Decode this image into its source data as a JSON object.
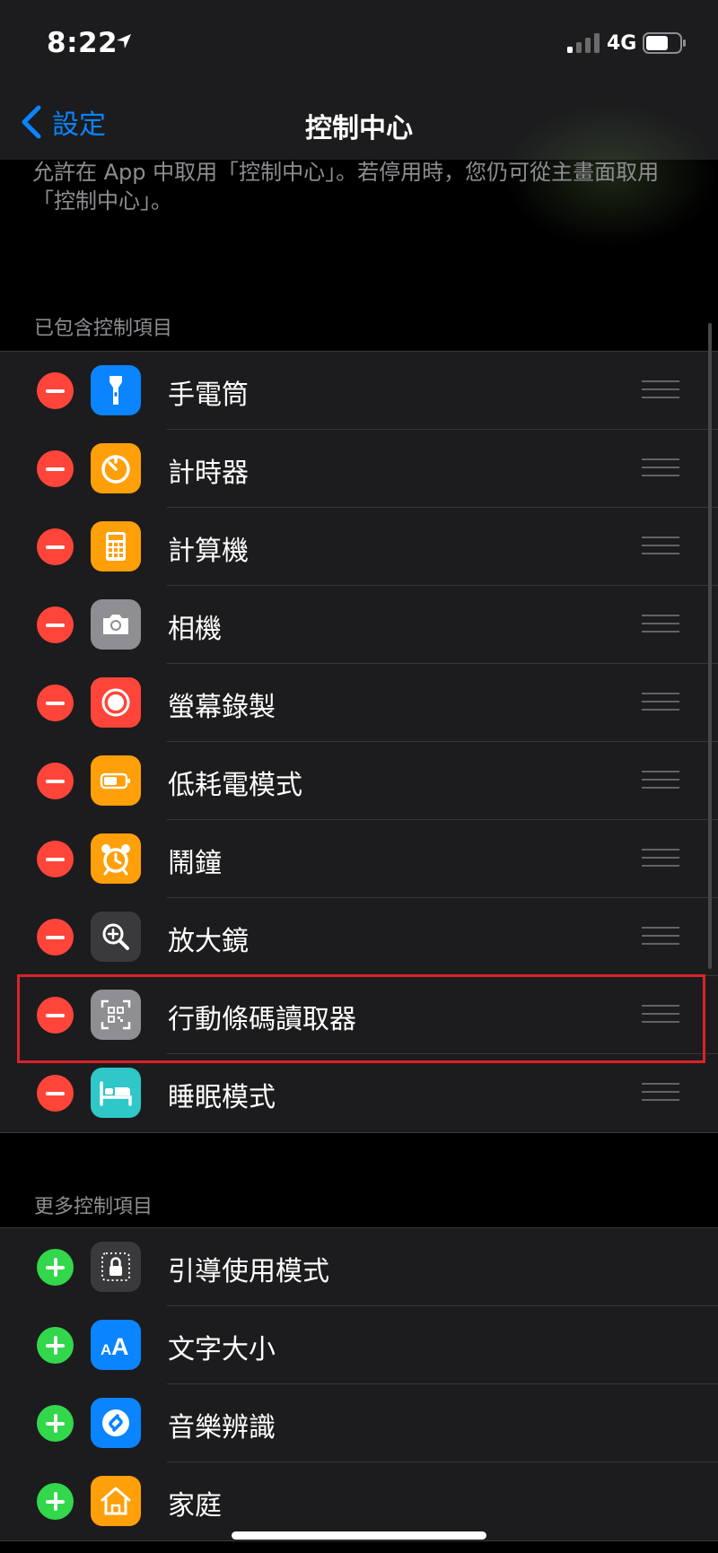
{
  "status_bar": {
    "time": "8:22",
    "network": "4G"
  },
  "nav": {
    "back_label": "設定",
    "title": "控制中心"
  },
  "description": "允許在 App 中取用「控制中心」。若停用時，您仍可從主畫面取用「控制中心」。",
  "included": {
    "header": "已包含控制項目",
    "items": [
      {
        "label": "手電筒",
        "icon": "flashlight-icon",
        "color": "#0a84ff"
      },
      {
        "label": "計時器",
        "icon": "timer-icon",
        "color": "#ff9f0a"
      },
      {
        "label": "計算機",
        "icon": "calculator-icon",
        "color": "#ff9f0a"
      },
      {
        "label": "相機",
        "icon": "camera-icon",
        "color": "#8e8e93"
      },
      {
        "label": "螢幕錄製",
        "icon": "screen-record-icon",
        "color": "#ff453a"
      },
      {
        "label": "低耗電模式",
        "icon": "battery-icon",
        "color": "#ff9f0a"
      },
      {
        "label": "鬧鐘",
        "icon": "alarm-icon",
        "color": "#ff9f0a"
      },
      {
        "label": "放大鏡",
        "icon": "magnifier-icon",
        "color": "#3a3a3c"
      },
      {
        "label": "行動條碼讀取器",
        "icon": "qr-scanner-icon",
        "color": "#8e8e93"
      },
      {
        "label": "睡眠模式",
        "icon": "bed-icon",
        "color": "#2fc7c8"
      }
    ]
  },
  "more": {
    "header": "更多控制項目",
    "items": [
      {
        "label": "引導使用模式",
        "icon": "guided-access-lock-icon",
        "color": "#3a3a3c"
      },
      {
        "label": "文字大小",
        "icon": "text-size-icon",
        "color": "#0a84ff"
      },
      {
        "label": "音樂辨識",
        "icon": "shazam-icon",
        "color": "#0a84ff"
      },
      {
        "label": "家庭",
        "icon": "home-icon",
        "color": "#ff9f0a"
      }
    ]
  },
  "colors": {
    "remove": "#ff453a",
    "add": "#32d74b",
    "accent": "#0a84ff",
    "highlight": "#d9232b"
  }
}
